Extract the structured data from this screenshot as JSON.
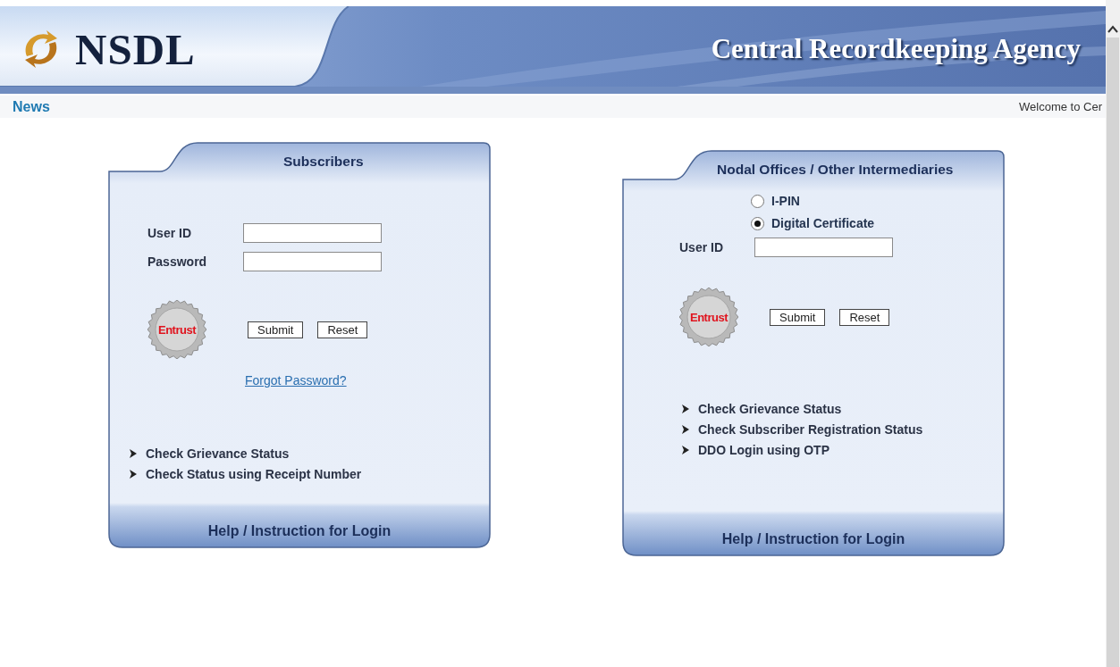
{
  "header": {
    "logo_text": "NSDL",
    "agency_title": "Central Recordkeeping Agency"
  },
  "news_bar": {
    "label": "News",
    "ticker": "Welcome to Cer"
  },
  "panels": [
    {
      "kind": "subscriber",
      "title": "Subscribers",
      "fields": [
        {
          "label": "User ID"
        },
        {
          "label": "Password"
        }
      ],
      "seal": "Entrust",
      "buttons": [
        "Submit",
        "Reset"
      ],
      "forgot_link": "Forgot Password?",
      "links": [
        "Check Grievance Status",
        "Check Status using Receipt Number"
      ],
      "footer": "Help / Instruction for Login"
    },
    {
      "kind": "nodal",
      "title": "Nodal Offices / Other Intermediaries",
      "login_options": [
        {
          "label": "I-PIN",
          "selected": false
        },
        {
          "label": "Digital Certificate",
          "selected": true
        }
      ],
      "fields": [
        {
          "label": "User ID"
        }
      ],
      "seal": "Entrust",
      "buttons": [
        "Submit",
        "Reset"
      ],
      "links": [
        "Check Grievance Status",
        "Check Subscriber Registration Status",
        "DDO Login using OTP"
      ],
      "footer": "Help / Instruction for Login"
    }
  ]
}
